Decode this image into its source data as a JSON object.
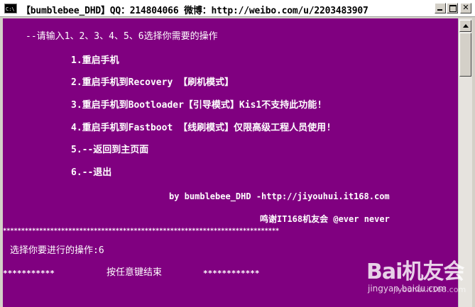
{
  "window": {
    "icon_label": "C:\\",
    "title": "【bumblebee_DHD】QQ：214804066 微博：http://weibo.com/u/2203483907"
  },
  "console": {
    "prompt": "--请输入1、2、3、4、5、6选择你需要的操作",
    "options": [
      "1.重启手机",
      "2.重启手机到Recovery  【刷机模式】",
      "3.重启手机到Bootloader【引导模式】Kis1不支持此功能!",
      "4.重启手机到Fastboot  【线刷模式】仅限高级工程人员使用!",
      "5.--返回到主页面",
      "6.--退出"
    ],
    "credit_line": "by bumblebee_DHD -http://jiyouhui.it168.com",
    "thanks_line": "鸣谢IT168机友会 @ever never",
    "separator": "****************************************************************************",
    "selection_line": "选择你要进行的操作:6",
    "end_stars_left": "***********",
    "end_message": "按任意键结束",
    "end_stars_right": "************"
  },
  "watermark": {
    "brand": "Bai机友会",
    "url": "jingyan.baidu.com",
    "url2": "jiyouhui.it168.com"
  },
  "colors": {
    "console_bg": "#800080",
    "console_fg": "#ffffff"
  }
}
